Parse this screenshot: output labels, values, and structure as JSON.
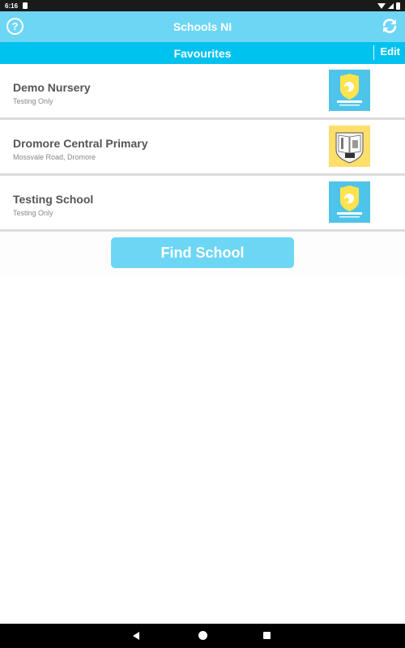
{
  "status_bar": {
    "time": "6:16"
  },
  "header": {
    "title": "Schools NI",
    "help_icon": "?",
    "refresh_icon": "refresh-icon"
  },
  "sub_header": {
    "title": "Favourites",
    "edit_label": "Edit"
  },
  "favourites": [
    {
      "name": "Demo Nursery",
      "subtitle": "Testing Only",
      "logo": "schools-ni-logo",
      "logo_text": "SCHOOLS"
    },
    {
      "name": "Dromore Central Primary",
      "subtitle": "Mossvale Road, Dromore",
      "logo": "school-crest-logo",
      "logo_text": ""
    },
    {
      "name": "Testing School",
      "subtitle": "Testing Only",
      "logo": "schools-ni-logo",
      "logo_text": "SCHOOLS"
    }
  ],
  "find_button": {
    "label": "Find School"
  },
  "colors": {
    "header": "#6dd6f4",
    "sub_header": "#00c2ef",
    "button": "#6dd6f4"
  }
}
